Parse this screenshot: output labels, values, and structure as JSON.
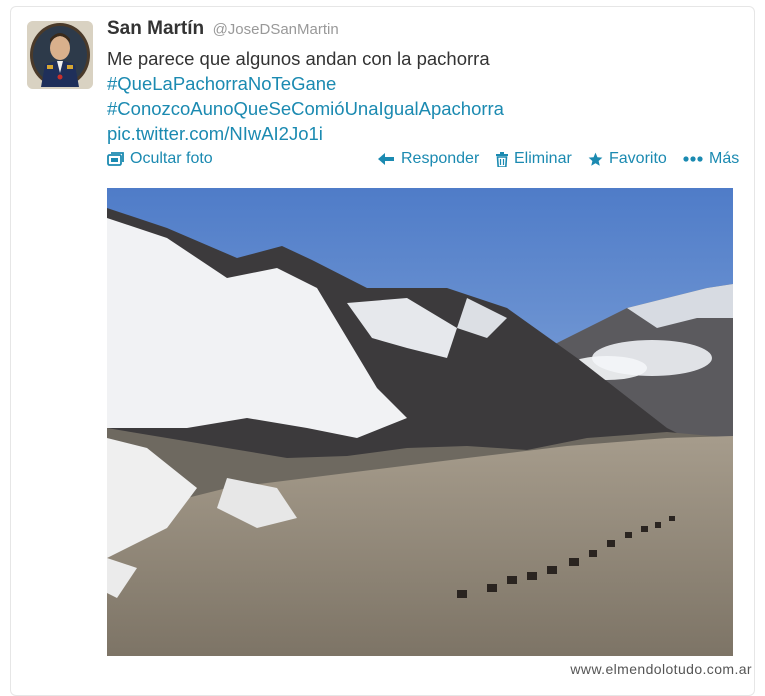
{
  "tweet": {
    "display_name": "San Martín",
    "handle": "@JoseDSanMartin",
    "text_line": "Me parece que algunos andan con la pachorra",
    "hashtag_1": "#QueLaPachorraNoTeGane",
    "hashtag_2": "#ConozcoAunoQueSeComióUnaIgualApachorra",
    "pic_link": "pic.twitter.com/NIwAI2Jo1i"
  },
  "actions": {
    "hide_photo": "Ocultar foto",
    "reply": "Responder",
    "delete": "Eliminar",
    "favorite": "Favorito",
    "more": "Más"
  },
  "watermark": "www.elmendolotudo.com.ar",
  "colors": {
    "link": "#1b8ab1",
    "name": "#333333",
    "handle": "#999999",
    "border": "#e6e6e6"
  },
  "icons": {
    "hide_photo": "photo-icon",
    "reply": "reply-arrow-icon",
    "delete": "trash-icon",
    "favorite": "star-icon",
    "more": "ellipsis-icon"
  }
}
